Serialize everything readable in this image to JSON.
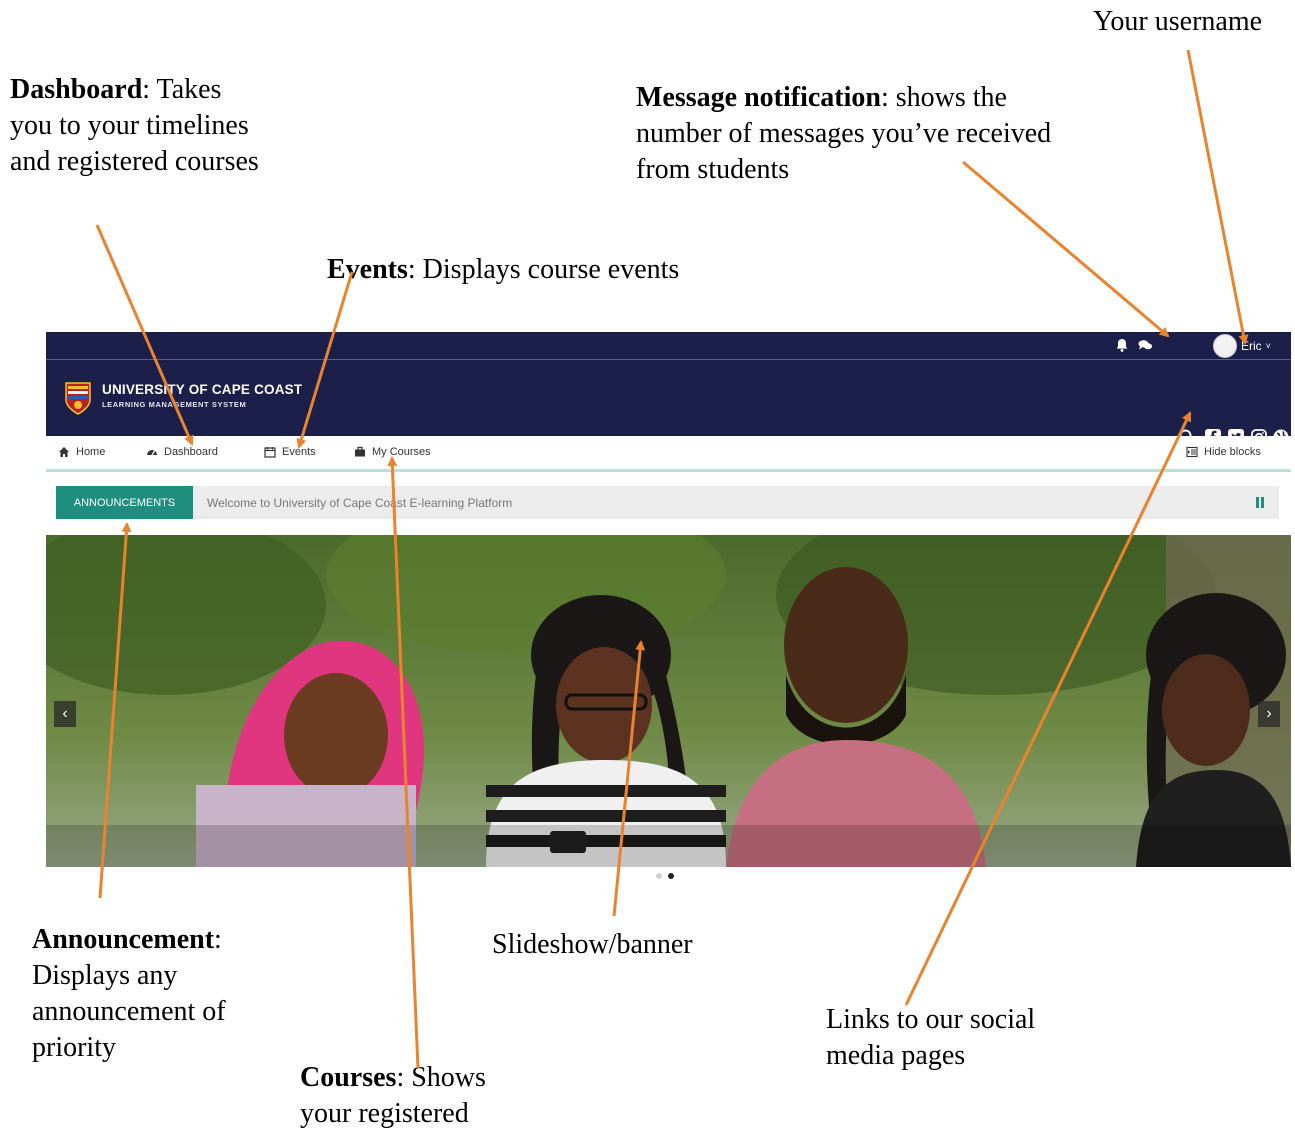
{
  "annotations": {
    "username": "Your username",
    "dashboard": {
      "bold": "Dashboard",
      "text": ": Takes you to your timelines and registered courses"
    },
    "message": {
      "bold": "Message notification",
      "text": ": shows the number of messages you’ve received from students"
    },
    "events": {
      "bold": "Events",
      "text": ": Displays course events"
    },
    "announcement": {
      "bold": "Announcement",
      "text": ": Displays any announcement of priority"
    },
    "slideshow": "Slideshow/banner",
    "social": "Links to our social media pages",
    "courses": {
      "bold": "Courses",
      "text": ": Shows your registered"
    }
  },
  "topbar": {
    "username": "Eric",
    "caret": "˅"
  },
  "brand": {
    "title": "UNIVERSITY OF CAPE COAST",
    "subtitle": "LEARNING MANAGEMENT SYSTEM"
  },
  "nav": {
    "home": "Home",
    "dashboard": "Dashboard",
    "events": "Events",
    "mycourses": "My Courses",
    "hideblocks": "Hide blocks"
  },
  "announcement": {
    "label": "ANNOUNCEMENTS",
    "text": "Welcome to University of Cape Coast E-learning Platform"
  },
  "slideshow": {
    "prev": "‹",
    "next": "›",
    "slides": 2,
    "active_slide": 2
  },
  "colors": {
    "header": "#1c1f4a",
    "accent": "#1e8e7e",
    "arrow": "#e8832e"
  }
}
